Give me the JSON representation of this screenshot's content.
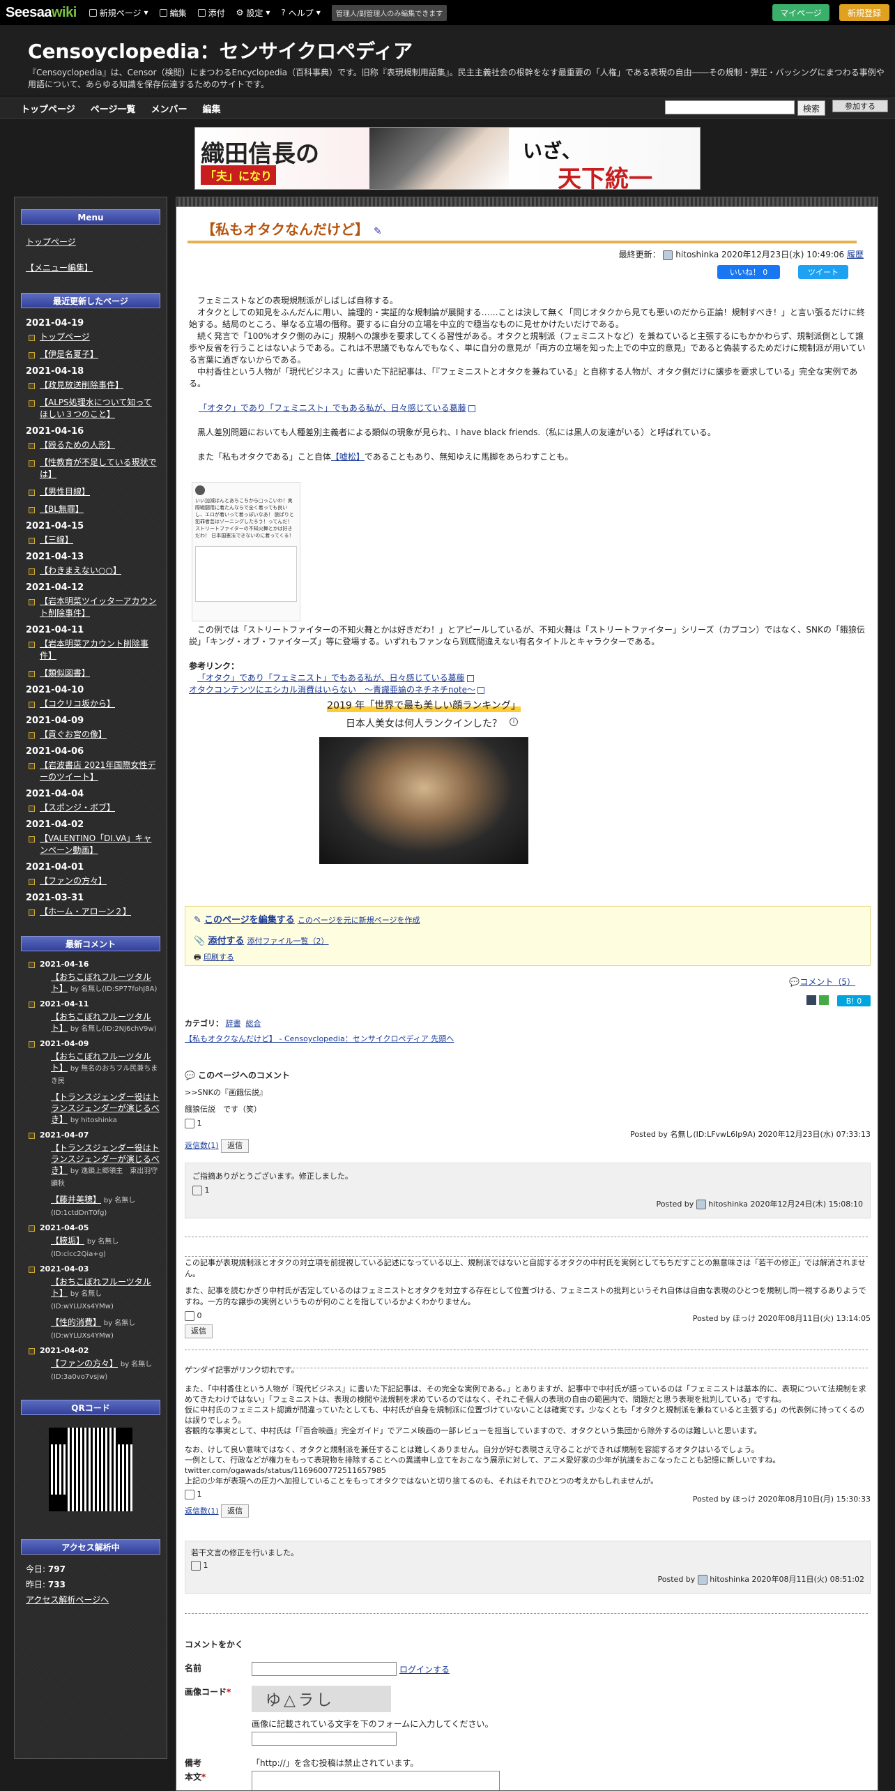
{
  "topbar": {
    "logo_a": "Seesaa",
    "logo_b": "wiki",
    "new_page": "新規ページ",
    "edit": "編集",
    "attach": "添付",
    "settings": "設定",
    "help": "ヘルプ",
    "note": "管理人/副管理人のみ編集できます",
    "mypage": "マイページ",
    "newreg": "新規登録"
  },
  "header": {
    "title": "Censoyclopedia：センサイクロペディア",
    "desc": "『Censoyclopedia』は、Censor（検閲）にまつわるEncyclopedia（百科事典）です。旧称『表現規制用語集』。民主主義社会の根幹をなす最重要の「人権」である表現の自由――その規制・弾圧・バッシングにまつわる事例や用語について、あらゆる知識を保存伝達するためのサイトです。"
  },
  "nav": {
    "items": [
      "トップページ",
      "ページ一覧",
      "メンバー",
      "編集"
    ],
    "search_btn": "検索",
    "join": "参加する"
  },
  "banner": {
    "l1": "織田信長の",
    "l2": "「夫」になり",
    "r1": "いざ、",
    "r2": "天下統一"
  },
  "sidebar": {
    "menu_head": "Menu",
    "menu_items": [
      "トップページ",
      "【メニュー編集】"
    ],
    "recent_head": "最近更新したページ",
    "recent": [
      {
        "date": "2021-04-19",
        "items": [
          "トップページ",
          "【伊是名夏子】"
        ]
      },
      {
        "date": "2021-04-18",
        "items": [
          "【政見放送削除事件】",
          "【ALPS処理水について知ってほしい３つのこと】"
        ]
      },
      {
        "date": "2021-04-16",
        "items": [
          "【殴るための人形】",
          "【性教育が不足している現状では】",
          "【男性目線】",
          "【BL無罪】"
        ]
      },
      {
        "date": "2021-04-15",
        "items": [
          "【三線】"
        ]
      },
      {
        "date": "2021-04-13",
        "items": [
          "【わきまえない○○】"
        ]
      },
      {
        "date": "2021-04-12",
        "items": [
          "【岩本明菜ツイッターアカウント削除事件】"
        ]
      },
      {
        "date": "2021-04-11",
        "items": [
          "【岩本明菜アカウント削除事件】",
          "【類似図書】"
        ]
      },
      {
        "date": "2021-04-10",
        "items": [
          "【コクリコ坂から】"
        ]
      },
      {
        "date": "2021-04-09",
        "items": [
          "【貢ぐお宮の像】"
        ]
      },
      {
        "date": "2021-04-06",
        "items": [
          "【岩波書店 2021年国際女性デーのツイート】"
        ]
      },
      {
        "date": "2021-04-04",
        "items": [
          "【スポンジ・ボブ】"
        ]
      },
      {
        "date": "2021-04-02",
        "items": [
          "【VALENTINO「DI.VA」キャンペーン動画】"
        ]
      },
      {
        "date": "2021-04-01",
        "items": [
          "【ファンの方々】"
        ]
      },
      {
        "date": "2021-03-31",
        "items": [
          "【ホーム・アローン２】"
        ]
      }
    ],
    "comments_head": "最新コメント",
    "comments": [
      {
        "date": "2021-04-16",
        "link": "【おちこぼれフルーツタルト】",
        "by": "by 名無し(ID:SP77fohJ8A)"
      },
      {
        "date": "2021-04-11",
        "link": "【おちこぼれフルーツタルト】",
        "by": "by 名無し(ID:2NJ6chV9w)"
      },
      {
        "date": "2021-04-09",
        "link": "【おちこぼれフルーツタルト】",
        "by": "by 無名のおちフル民兼ちまき民"
      },
      {
        "date": "",
        "link": "【トランスジェンダー役はトランスジェンダーが演じるべき】",
        "by": "by hitoshinka"
      },
      {
        "date": "2021-04-07",
        "link": "【トランスジェンダー役はトランスジェンダーが演じるべき】",
        "by": "by 逸鎖上郷領主　東出羽守顕秋"
      },
      {
        "date": "",
        "link": "【藤井美穂】",
        "by": "by 名無し(ID:1ctdDnT0fg)"
      },
      {
        "date": "2021-04-05",
        "link": "【腋垢】",
        "by": "by 名無し(ID:clcc2Qia+g)"
      },
      {
        "date": "2021-04-03",
        "link": "【おちこぼれフルーツタルト】",
        "by": "by 名無し(ID:wYLUXs4YMw)"
      },
      {
        "date": "",
        "link": "【性的消費】",
        "by": "by 名無し(ID:wYLUXs4YMw)"
      },
      {
        "date": "2021-04-02",
        "link": "【ファンの方々】",
        "by": "by 名無し(ID:3a0vo7vsjw)"
      }
    ],
    "qr_head": "QRコード",
    "access_head": "アクセス解析中",
    "today_label": "今日:",
    "today": "797",
    "yesterday_label": "昨日:",
    "yesterday": "733",
    "access_link": "アクセス解析ページへ"
  },
  "page": {
    "title": "【私もオタクなんだけど】",
    "updated_label": "最終更新：",
    "updated_user": "hitoshinka",
    "updated_at": "2020年12月23日(水) 10:49:06",
    "history": "履歴",
    "fb": "いいね！ 0",
    "tw": "ツイート",
    "p1": "フェミニストなどの表現規制派がしばしば自称する。",
    "p2": "オタクとしての知見をふんだんに用い、論理的・実証的な規制論が展開する……ことは決して無く「同じオタクから見ても悪いのだから正論！規制すべき！」と言い張るだけに終始する。結局のところ、単なる立場の僭称。要するに自分の立場を中立的で穏当なものに見せかけたいだけである。",
    "p3": "続く発言で「100%オタク側のみに」規制への譲歩を要求してくる習性がある。オタクと規制派（フェミニストなど）を兼ねていると主張するにもかかわらず、規制派側として譲歩や反省を行うことはないようである。これは不思議でもなんでもなく、単に自分の意見が「両方の立場を知った上での中立的意見」であると偽装するためだけに規制派が用いている言葉に過ぎないからである。",
    "p4": "中村香住という人物が「現代ビジネス」に書いた下記記事は、「『フェミニストとオタクを兼ねている』と自称する人物が、オタク側だけに譲歩を要求している」完全な実例である。",
    "link1": "「オタク」であり「フェミニスト」でもある私が、日々感じている葛藤",
    "p5": "黒人差別問題においても人種差別主義者による類似の現象が見られ、I have black friends.（私には黒人の友達がいる）と呼ばれている。",
    "p6a": "また「私もオタクである」こと自体",
    "p6link": "【嘘松】",
    "p6b": "であることもあり、無知ゆえに馬脚をあらわすことも。",
    "tweet_text": "いい加減ほんとあちこちから□っこいわ！実際戦闘用に着たんならで全く着っても良いし、エロが着いって着っぽいなあ！ 腕ぱりと犯罪者芸はゾーニングしたろう！ってんだ！ ストリートファイターの不知火舞とかは好きだわ！ 日本国憲法できないのに着ってくる！",
    "p7": "この例では「ストリートファイターの不知火舞とかは好きだわ！」とアピールしているが、不知火舞は「ストリートファイター」シリーズ（カプコン）ではなく、SNKの「餓狼伝説」「キング・オブ・ファイターズ」等に登場する。いずれもファンなら到底間違えない有名タイトルとキャラクターである。",
    "ref_label": "参考リンク：",
    "ref1": "「オタク」であり「フェミニスト」でもある私が、日々感じている葛藤",
    "ref2": "オタクコンテンツにエシカル消費はいらない　～青識亜論のネチネチnote～",
    "ad_title": "2019 年「世界で最も美しい顔ランキング」",
    "ad_sub": "日本人美女は何人ランクインした？",
    "edit_page": "このページを編集する",
    "new_from": "このページを元に新規ページを作成",
    "attach": "添付する",
    "attach_list": "添付ファイル一覧（2）",
    "print": "印刷する",
    "comment_count": "コメント（5）",
    "hatena": "0",
    "category_label": "カテゴリ：",
    "cat1": "辞書",
    "cat2": "総合",
    "top_link": "【私もオタクなんだけど】 - Censoyclopedia：センサイクロペディア 先頭へ",
    "comments_title": "このページへのコメント",
    "c1_text1": ">>SNKの『画餓伝説』",
    "c1_text2": "餓狼伝説　です（笑）",
    "c1_likes": "1",
    "c1_reply_count": "返信数(1)",
    "reply": "返信",
    "c1_by": "Posted by 名無し(ID:LFvwL6lp9A) 2020年12月23日(水) 07:33:13",
    "c1r_text": "ご指摘ありがとうございます。修正しました。",
    "c1r_likes": "1",
    "c1r_by_pre": "Posted by",
    "c1r_user": "hitoshinka",
    "c1r_at": "2020年12月24日(木) 15:08:10",
    "c2_text1": "この記事が表現規制派とオタクの対立項を前提視している記述になっている以上、規制派ではないと自認するオタクの中村氏を実例としてもちだすことの無意味さは「若干の修正」では解消されません。",
    "c2_text2": "また、記事を読むかぎり中村氏が否定しているのはフェミニストとオタクを対立する存在として位置づける、フェミニストの批判というそれ自体は自由な表現のひとつを規制し同一視するありようですね。一方的な譲歩の実例というものが何のことを指しているかよくわかりません。",
    "c2_likes": "0",
    "c2_by": "Posted by ほっけ 2020年08月11日(火) 13:14:05",
    "c3_text1": "ゲンダイ記事がリンク切れです。",
    "c3_text2": "また、「中村香住という人物が『現代ビジネス』に書いた下記記事は、その完全な実例である。」とありますが、記事中で中村氏が語っているのは「フェミニストは基本的に、表現について法規制を求めてきたわけではない」「フェミニストは、表現の検閲や法規制を求めているのではなく、それこそ個人の表現の自由の範囲内で、問題だと思う表現を批判している」ですね。",
    "c3_text3": "仮に中村氏のフェミニスト認識が間違っていたとしても、中村氏が自身を規制派に位置づけていないことは確実です。少なくとも「オタクと規制派を兼ねていると主張する」の代表例に持ってくるのは誤りでしょう。",
    "c3_text4": "客観的な事実として、中村氏は「『百合映画』完全ガイド」でアニメ映画の一部レビューを担当していますので、オタクという集団から除外するのは難しいと思います。",
    "c3_text5": "なお、けして良い意味ではなく、オタクと規制派を兼任することは難しくありません。自分が好む表現さえ守ることができれば規制を容認するオタクはいるでしょう。",
    "c3_text6": "一例として、行政などが権力をもって表現物を排除することへの異議申し立てをおこなう展示に対して、アニメ愛好家の少年が抗議をおこなったことも記憶に新しいですね。",
    "c3_text7": "twitter.com/ogawads/status/1169600772511657985",
    "c3_text8": "上記の少年が表現への圧力へ加担していることをもってオタクではないと切り捨てるのも、それはそれでひとつの考えかもしれませんが。",
    "c3_likes": "1",
    "c3_reply_count": "返信数(1)",
    "c3_by": "Posted by ほっけ 2020年08月10日(月) 15:30:33",
    "c3r_text": "若干文言の修正を行いました。",
    "c3r_likes": "1",
    "c3r_by_pre": "Posted by",
    "c3r_user": "hitoshinka",
    "c3r_at": "2020年08月11日(火) 08:51:02",
    "form_title": "コメントをかく",
    "name_label": "名前",
    "login": "ログインする",
    "captcha_label": "画像コード",
    "captcha_help": "画像に記載されている文字を下のフォームに入力してください。",
    "captcha_text": "ゆ△ラし",
    "note_label": "備考",
    "note_text": "「http://」を含む投稿は禁止されています。",
    "body_label": "本文"
  }
}
